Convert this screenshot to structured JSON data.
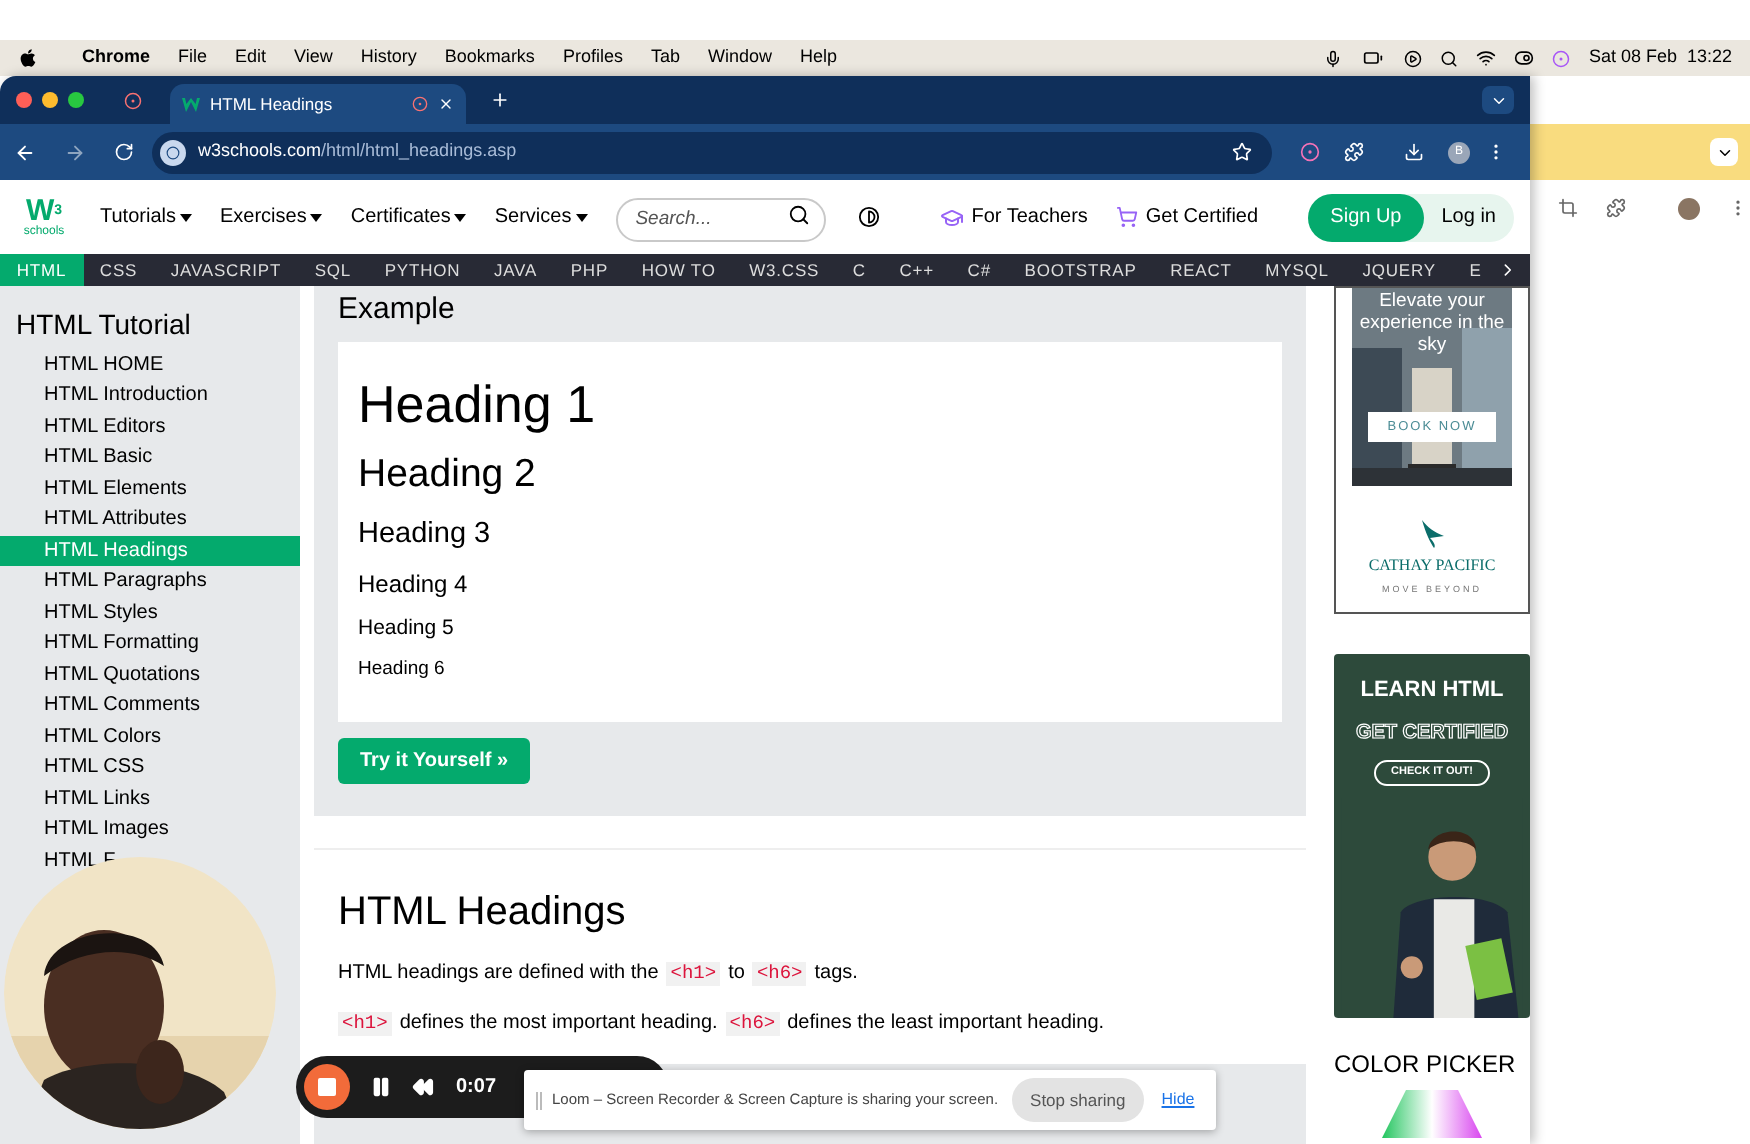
{
  "menubar": {
    "app": "Chrome",
    "items": [
      "File",
      "Edit",
      "View",
      "History",
      "Bookmarks",
      "Profiles",
      "Tab",
      "Window",
      "Help"
    ],
    "clock": "Sat 08 Feb  13:22"
  },
  "browser": {
    "tabs": [
      {
        "title": "HTML Headings",
        "selected": true
      }
    ],
    "url_host": "w3schools.com",
    "url_path": "/html/html_headings.asp",
    "profile": "B"
  },
  "header": {
    "logo": {
      "mark": "W",
      "sup": "3",
      "sub": "schools"
    },
    "nav": [
      "Tutorials",
      "Exercises",
      "Certificates",
      "Services"
    ],
    "search_placeholder": "Search...",
    "for_teachers": "For Teachers",
    "get_certified": "Get Certified",
    "sign_up": "Sign Up",
    "log_in": "Log in"
  },
  "topnav": [
    {
      "label": "HTML",
      "selected": true
    },
    {
      "label": "CSS",
      "selected": false
    },
    {
      "label": "JAVASCRIPT",
      "selected": false
    },
    {
      "label": "SQL",
      "selected": false
    },
    {
      "label": "PYTHON",
      "selected": false
    },
    {
      "label": "JAVA",
      "selected": false
    },
    {
      "label": "PHP",
      "selected": false
    },
    {
      "label": "HOW TO",
      "selected": false
    },
    {
      "label": "W3.CSS",
      "selected": false
    },
    {
      "label": "C",
      "selected": false
    },
    {
      "label": "C++",
      "selected": false
    },
    {
      "label": "C#",
      "selected": false
    },
    {
      "label": "BOOTSTRAP",
      "selected": false
    },
    {
      "label": "REACT",
      "selected": false
    },
    {
      "label": "MYSQL",
      "selected": false
    },
    {
      "label": "JQUERY",
      "selected": false
    },
    {
      "label": "E",
      "selected": false
    }
  ],
  "sidebar": {
    "title": "HTML Tutorial",
    "items": [
      {
        "label": "HTML HOME",
        "selected": false
      },
      {
        "label": "HTML Introduction",
        "selected": false
      },
      {
        "label": "HTML Editors",
        "selected": false
      },
      {
        "label": "HTML Basic",
        "selected": false
      },
      {
        "label": "HTML Elements",
        "selected": false
      },
      {
        "label": "HTML Attributes",
        "selected": false
      },
      {
        "label": "HTML Headings",
        "selected": true
      },
      {
        "label": "HTML Paragraphs",
        "selected": false
      },
      {
        "label": "HTML Styles",
        "selected": false
      },
      {
        "label": "HTML Formatting",
        "selected": false
      },
      {
        "label": "HTML Quotations",
        "selected": false
      },
      {
        "label": "HTML Comments",
        "selected": false
      },
      {
        "label": "HTML Colors",
        "selected": false
      },
      {
        "label": "HTML CSS",
        "selected": false
      },
      {
        "label": "HTML Links",
        "selected": false
      },
      {
        "label": "HTML Images",
        "selected": false
      },
      {
        "label": "HTML F",
        "selected": false
      }
    ]
  },
  "example": {
    "title": "Example",
    "headings": [
      "Heading 1",
      "Heading 2",
      "Heading 3",
      "Heading 4",
      "Heading 5",
      "Heading 6"
    ],
    "button": "Try it Yourself »"
  },
  "section": {
    "title": "HTML Headings",
    "paragraphs": [
      [
        {
          "kind": "text",
          "text": "HTML headings are defined with the"
        },
        {
          "kind": "code",
          "text": "<h1>"
        },
        {
          "kind": "text",
          "text": "to"
        },
        {
          "kind": "code",
          "text": "<h6>"
        },
        {
          "kind": "text",
          "text": "tags."
        }
      ],
      [
        {
          "kind": "code",
          "text": "<h1>"
        },
        {
          "kind": "text",
          "text": "defines the most important heading."
        },
        {
          "kind": "code",
          "text": "<h6>"
        },
        {
          "kind": "text",
          "text": "defines the least important heading."
        }
      ]
    ]
  },
  "ads": {
    "airline": {
      "headline": "Elevate your experience in the sky",
      "button": "BOOK NOW",
      "brand": "CATHAY PACIFIC",
      "tagline": "MOVE BEYOND"
    },
    "course": {
      "title": "LEARN HTML",
      "subtitle": "GET CERTIFIED",
      "button": "CHECK IT OUT!"
    }
  },
  "color_picker": "COLOR PICKER",
  "recorder": {
    "time": "0:07"
  },
  "share_bar": {
    "message": "Loom – Screen Recorder & Screen Capture is sharing your screen.",
    "stop": "Stop sharing",
    "hide": "Hide"
  }
}
